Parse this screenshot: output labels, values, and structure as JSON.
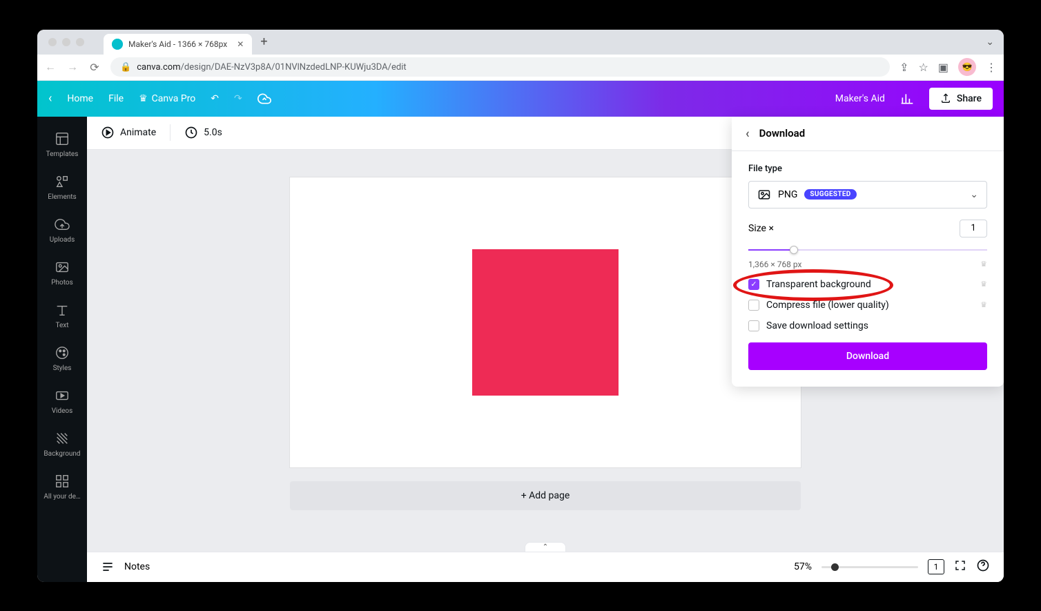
{
  "browser": {
    "tab_title": "Maker's Aid - 1366 × 768px",
    "url_domain": "canva.com",
    "url_path": "/design/DAE-NzV3p8A/01NVlNzdedLNP-KUWju3DA/edit"
  },
  "header": {
    "home": "Home",
    "file": "File",
    "canva_pro": "Canva Pro",
    "doc_name": "Maker's Aid",
    "share": "Share"
  },
  "sidenav": {
    "items": [
      "Templates",
      "Elements",
      "Uploads",
      "Photos",
      "Text",
      "Styles",
      "Videos",
      "Background",
      "All your de…"
    ]
  },
  "toolbar": {
    "animate": "Animate",
    "duration": "5.0s"
  },
  "canvas": {
    "add_page": "+ Add page"
  },
  "download": {
    "title": "Download",
    "file_type_label": "File type",
    "file_type_value": "PNG",
    "file_type_badge": "SUGGESTED",
    "size_label": "Size ×",
    "size_value": "1",
    "dimensions": "1,366 × 768 px",
    "opt_transparent": "Transparent background",
    "opt_compress": "Compress file (lower quality)",
    "opt_save": "Save download settings",
    "button": "Download"
  },
  "bottom": {
    "notes": "Notes",
    "zoom": "57%",
    "page_count": "1"
  }
}
